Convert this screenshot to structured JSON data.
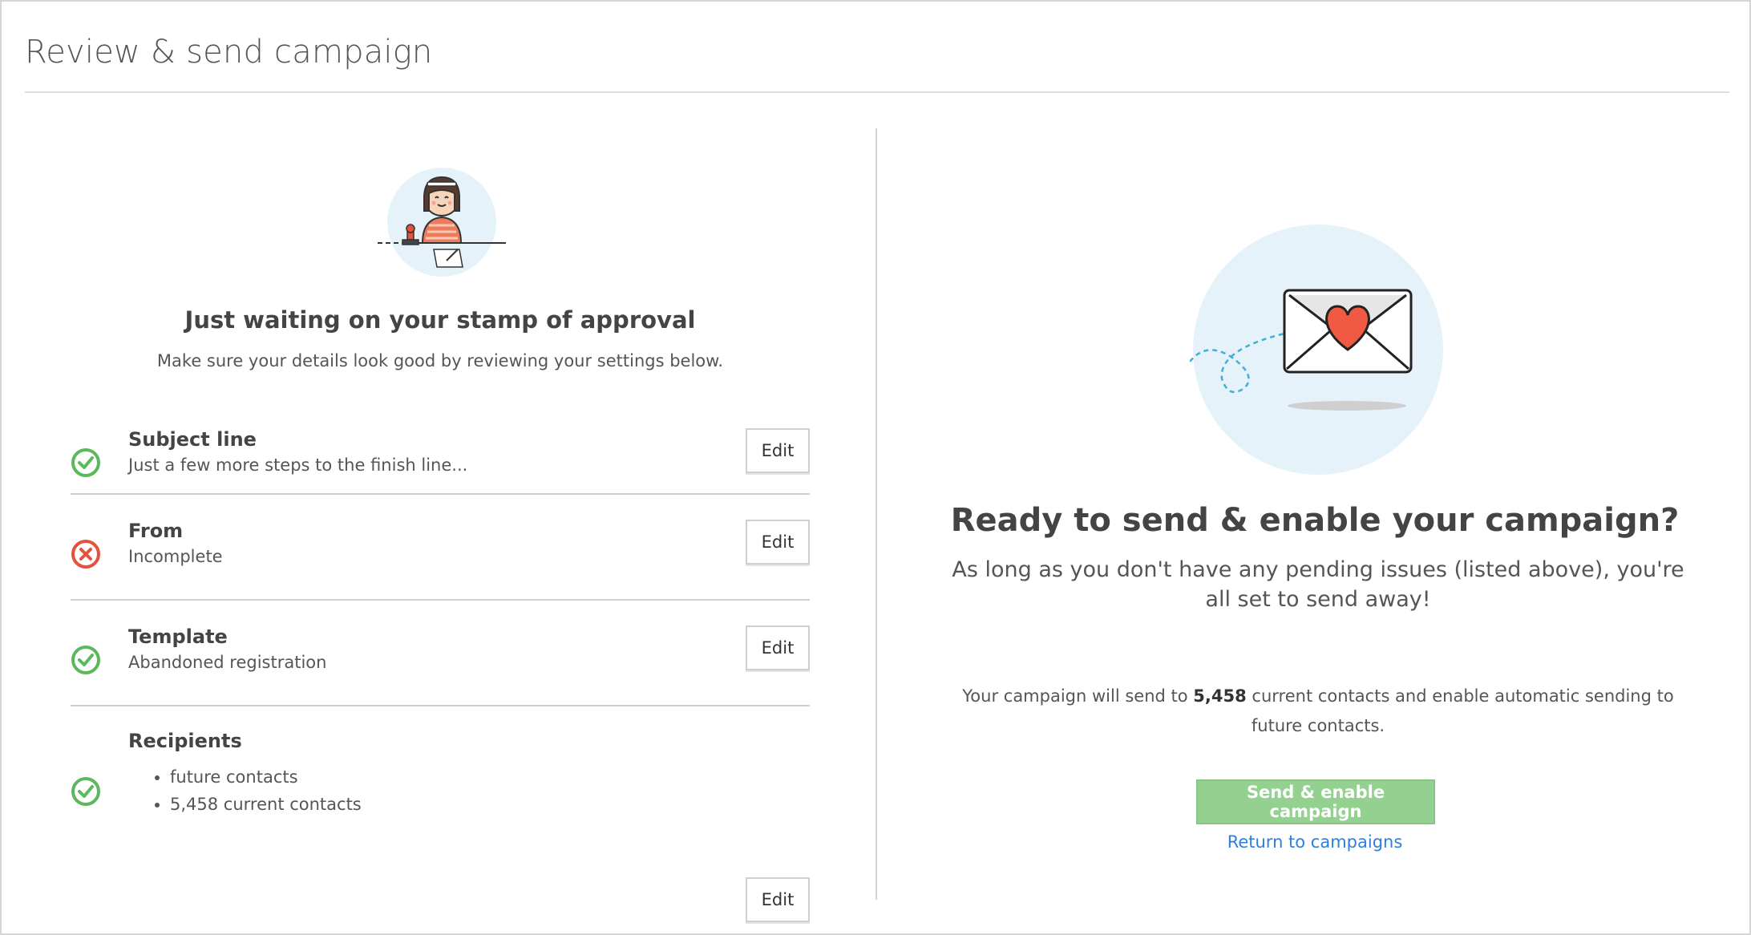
{
  "page": {
    "title": "Review & send campaign"
  },
  "review": {
    "heading": "Just waiting on your stamp of approval",
    "subheading": "Make sure your details look good by reviewing your settings below.",
    "edit_label": "Edit",
    "items": [
      {
        "title": "Subject line",
        "description": "Just a few more steps to the finish line...",
        "status": "complete"
      },
      {
        "title": "From",
        "description": "Incomplete",
        "status": "incomplete"
      },
      {
        "title": "Template",
        "description": "Abandoned registration",
        "status": "complete"
      },
      {
        "title": "Recipients",
        "status": "complete",
        "list": [
          "future contacts",
          "5,458 current contacts"
        ]
      }
    ]
  },
  "send": {
    "heading": "Ready to send & enable your campaign?",
    "subheading": "As long as you don't have any pending issues (listed above), you're all set to send away!",
    "info_prefix": "Your campaign will send to",
    "info_count": "5,458",
    "info_suffix": "current contacts and enable automatic sending to future contacts.",
    "send_button": "Send & enable campaign",
    "return_link": "Return to campaigns"
  },
  "colors": {
    "complete": "#5cb85c",
    "incomplete": "#e4513d",
    "send_button": "#94d190",
    "link": "#2f7fd9"
  },
  "icons": {
    "complete": "check-circle-icon",
    "incomplete": "x-circle-icon"
  }
}
